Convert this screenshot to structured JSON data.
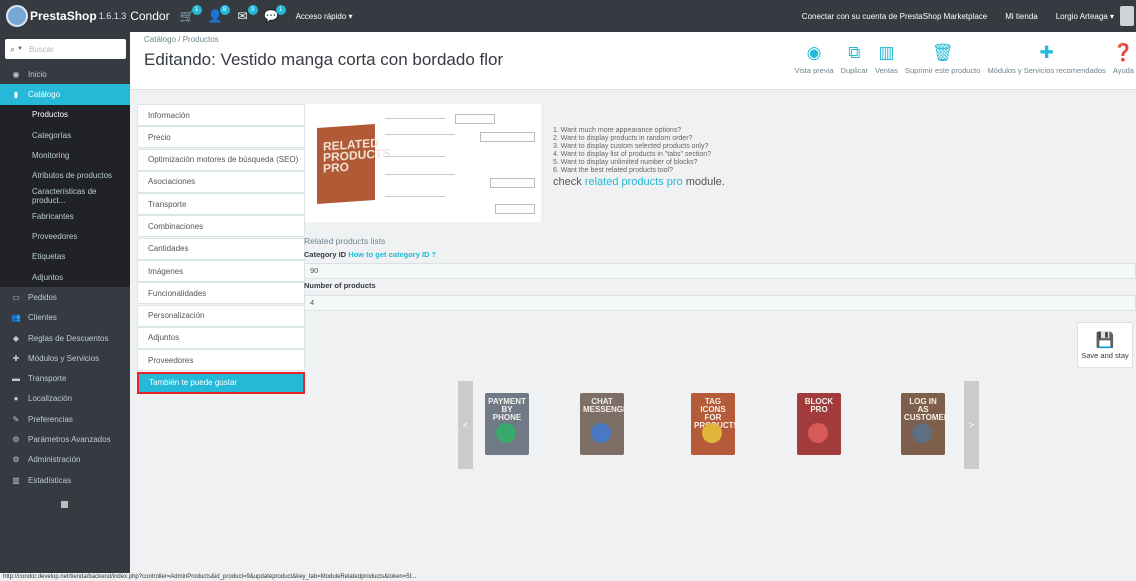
{
  "topbar": {
    "logo_text": "PrestaShop",
    "logo_version": "1.6.1.3",
    "shop_name": "Condor",
    "notifications": [
      {
        "icon": "cart-icon",
        "count": "1"
      },
      {
        "icon": "user-icon",
        "count": "8"
      },
      {
        "icon": "message-icon",
        "count": "3"
      },
      {
        "icon": "chat-icon",
        "count": "1"
      }
    ],
    "quick_access": "Acceso rápido ▾",
    "marketplace": "Conectar con su cuenta de PrestaShop Marketplace",
    "my_shop": "Mi tienda",
    "user": "Lorgio Arteaga ▾"
  },
  "sidebar": {
    "search_placeholder": "Buscar",
    "items_top": [
      {
        "label": "Inicio",
        "icon": "dashboard-icon"
      },
      {
        "label": "Catálogo",
        "icon": "book-icon"
      }
    ],
    "catalog_sub": [
      "Productos",
      "Categorías",
      "Monitoring",
      "Atributos de productos",
      "Características de product...",
      "Fabricantes",
      "Proveedores",
      "Etiquetas",
      "Adjuntos"
    ],
    "items_bottom": [
      {
        "label": "Pedidos",
        "icon": "credit-card-icon"
      },
      {
        "label": "Clientes",
        "icon": "users-icon"
      },
      {
        "label": "Reglas de Descuentos",
        "icon": "tag-icon"
      },
      {
        "label": "Módulos y Servicios",
        "icon": "puzzle-icon"
      },
      {
        "label": "Transporte",
        "icon": "truck-icon"
      },
      {
        "label": "Localización",
        "icon": "globe-icon"
      },
      {
        "label": "Preferencias",
        "icon": "wrench-icon"
      },
      {
        "label": "Parámetros Avanzados",
        "icon": "cogs-icon"
      },
      {
        "label": "Administración",
        "icon": "gear-icon"
      },
      {
        "label": "Estadísticas",
        "icon": "bar-chart-icon"
      }
    ]
  },
  "header": {
    "breadcrumb": "Catálogo  /  Productos",
    "title": "Editando: Vestido manga corta con bordado flor",
    "toolbar": [
      {
        "label": "Vista previa",
        "icon": "eye-icon"
      },
      {
        "label": "Duplicar",
        "icon": "copy-icon"
      },
      {
        "label": "Ventas",
        "icon": "bar-chart-icon"
      },
      {
        "label": "Suprimir este producto",
        "icon": "trash-icon"
      },
      {
        "label": "Módulos y Servicios recomendados",
        "icon": "puzzle-icon"
      },
      {
        "label": "Ayuda",
        "icon": "help-icon"
      }
    ]
  },
  "tabs": [
    "Información",
    "Precio",
    "Optimización motores de búsqueda (SEO)",
    "Asociaciones",
    "Transporte",
    "Combinaciones",
    "Cantidades",
    "Imágenes",
    "Funcionalidades",
    "Personalización",
    "Adjuntos",
    "Proveedores",
    "También te puede gustar"
  ],
  "promo": {
    "box_label": "RELATED PRODUCTS PRO",
    "lines": [
      "1. Want much more appearance options?",
      "2. Want to display products in random order?",
      "3. Want to display custom selected products only?",
      "4. Want to display list of products in \"tabs\" section?",
      "5. Want to display unlimited number of blocks?",
      "6. Want the best related products tool?"
    ],
    "check_prefix": "check ",
    "check_link": "related products pro",
    "check_suffix": " module."
  },
  "form": {
    "section_title": "Related products lists",
    "category_label": "Category ID",
    "category_help": "How to get category ID ?",
    "category_value": "90",
    "number_label": "Number of products",
    "number_value": "4"
  },
  "save_stay": "Save and stay",
  "carousel": {
    "prev": "<",
    "next": ">",
    "products": [
      {
        "name": "PAYMENT BY PHONE",
        "color": "#6f7a86",
        "accent": "#3aa86b"
      },
      {
        "name": "CHAT MESSENGER",
        "color": "#7e6f66",
        "accent": "#4a78c2"
      },
      {
        "name": "TAG ICONS FOR PRODUCTS",
        "color": "#b55b3a",
        "accent": "#e0b53a"
      },
      {
        "name": "BLOCK PRO",
        "color": "#a23c3c",
        "accent": "#d95a5a"
      },
      {
        "name": "LOG IN AS CUSTOMER",
        "color": "#7d5f4c",
        "accent": "#5e6f80"
      }
    ]
  },
  "statusbar": "http://condor.develop.net/tienda/backend/index.php?controller=AdminProducts&id_product=9&updateproduct&key_tab=ModuleRelatedproducts&token=5f..."
}
